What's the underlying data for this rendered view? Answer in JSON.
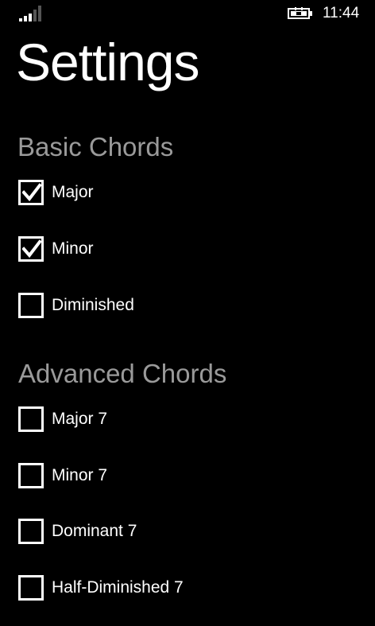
{
  "status_bar": {
    "time": "11:44",
    "signal_icon": "signal-strength-icon",
    "battery_icon": "battery-charging-icon"
  },
  "page": {
    "title": "Settings"
  },
  "sections": {
    "basic": {
      "title": "Basic Chords",
      "items": [
        {
          "label": "Major",
          "checked": true
        },
        {
          "label": "Minor",
          "checked": true
        },
        {
          "label": "Diminished",
          "checked": false
        }
      ]
    },
    "advanced": {
      "title": "Advanced Chords",
      "items": [
        {
          "label": "Major 7",
          "checked": false
        },
        {
          "label": "Minor 7",
          "checked": false
        },
        {
          "label": "Dominant 7",
          "checked": false
        },
        {
          "label": "Half-Diminished 7",
          "checked": false
        }
      ]
    }
  },
  "colors": {
    "background": "#000000",
    "foreground": "#ffffff",
    "section_header": "#9a9a9a"
  }
}
